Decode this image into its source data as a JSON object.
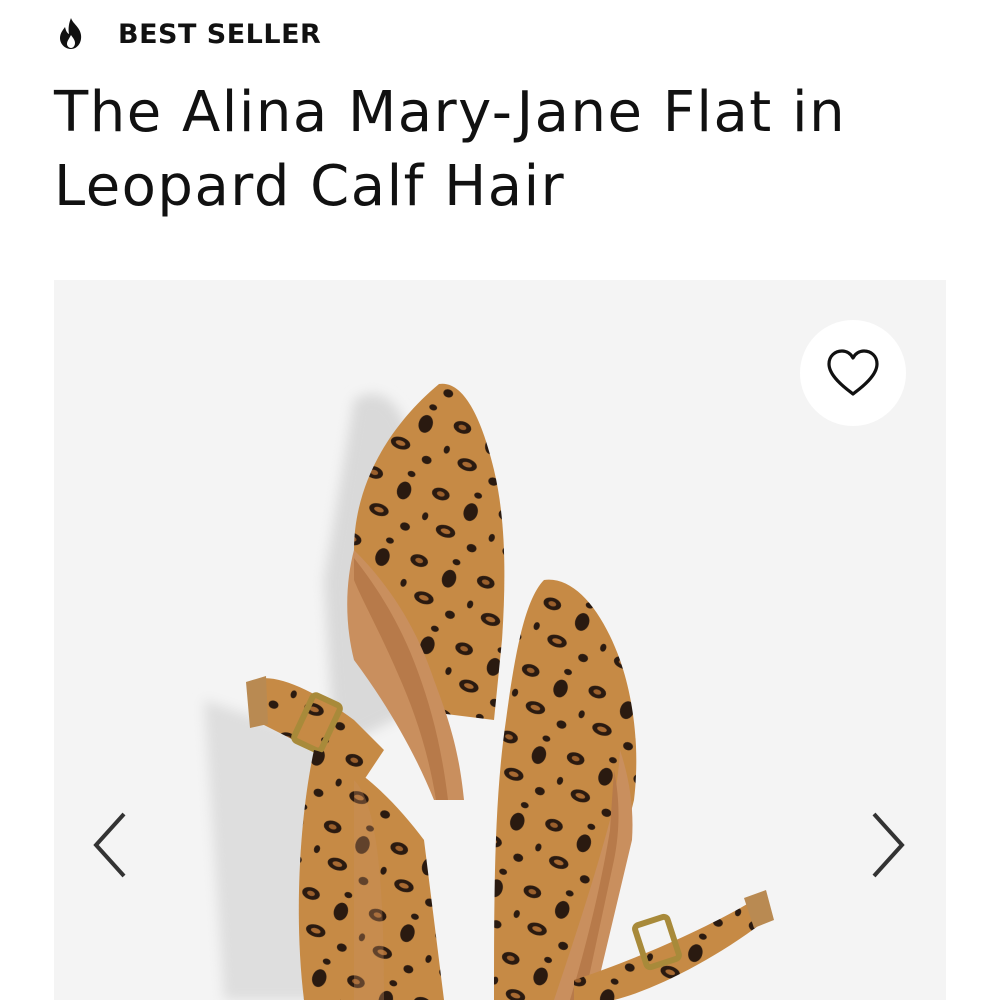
{
  "badge": {
    "icon": "flame-icon",
    "label": "BEST SELLER"
  },
  "product": {
    "title": "The Alina Mary-Jane Flat in Leopard Calf Hair"
  },
  "gallery": {
    "image_alt": "leopard calf hair mary-jane flats",
    "favorite_icon": "heart-outline-icon",
    "prev_icon": "chevron-left-icon",
    "next_icon": "chevron-right-icon"
  },
  "colors": {
    "text": "#111111",
    "gallery_bg": "#f4f4f4",
    "leopard_base": "#c68a45",
    "leopard_spot": "#2a1a10",
    "leather_lining": "#c98f5e",
    "buckle": "#a88a3a"
  }
}
